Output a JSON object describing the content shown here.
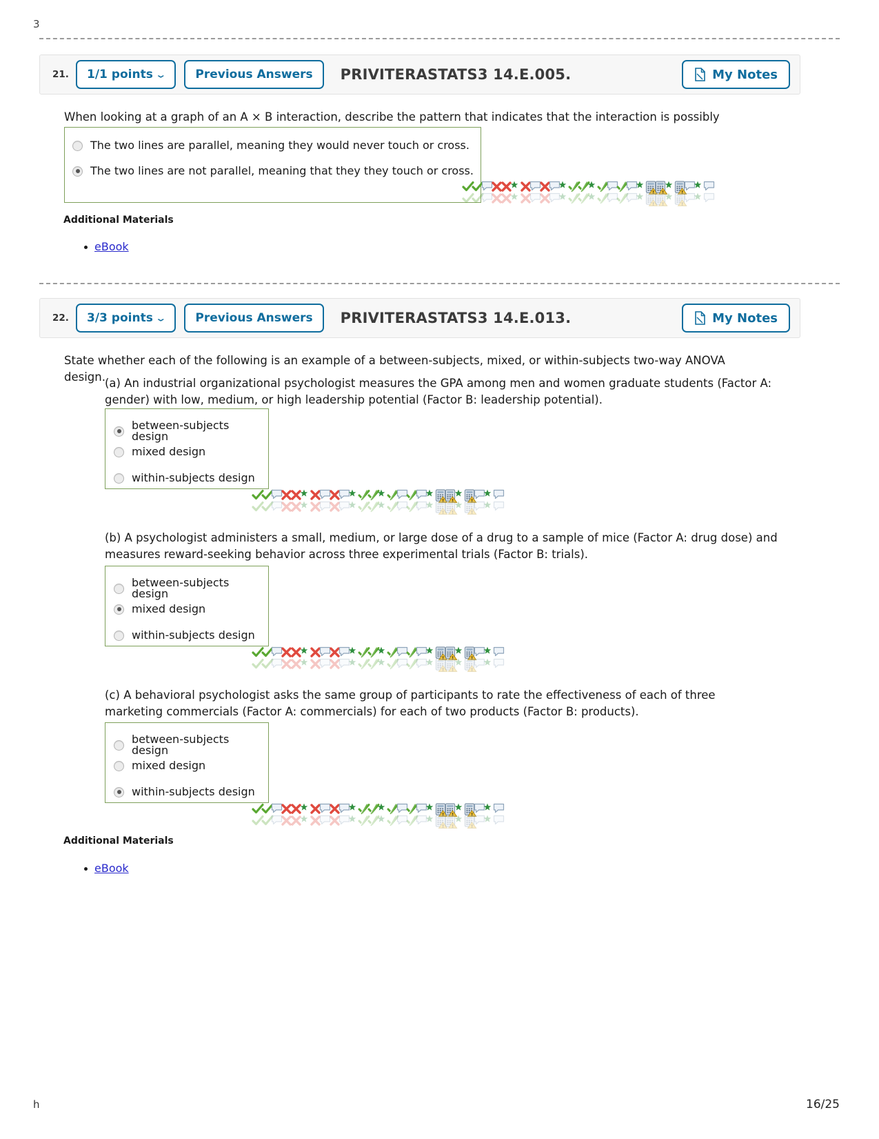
{
  "page": {
    "top_fragment": "3",
    "footer_fragment": "h",
    "page_indicator": "16/25",
    "accent_blue": "#0f6d9e",
    "link_blue": "#2a2acc",
    "option_box_border": "#7ea05a"
  },
  "questions": [
    {
      "number": "21.",
      "points_label": "1/1 points",
      "previous_answers_label": "Previous Answers",
      "code": "PRIVITERASTATS3 14.E.005.",
      "my_notes_label": "My Notes",
      "prompt": "When looking at a graph of an A  × B interaction, describe the pattern that indicates that the interaction is possibly significant.",
      "parts": [
        {
          "label": "",
          "text": "",
          "options": [
            {
              "label": "The two lines are parallel, meaning they would never touch or cross.",
              "selected": false
            },
            {
              "label": "The two lines are not parallel, meaning that they they touch or cross.",
              "selected": true
            }
          ]
        }
      ],
      "additional_materials_label": "Additional Materials",
      "materials": [
        "eBook"
      ]
    },
    {
      "number": "22.",
      "points_label": "3/3 points",
      "previous_answers_label": "Previous Answers",
      "code": "PRIVITERASTATS3 14.E.013.",
      "my_notes_label": "My Notes",
      "prompt": "State whether each of the following is an example of a between-subjects, mixed, or within-subjects two-way ANOVA design.",
      "parts": [
        {
          "label": "(a)",
          "text": "(a) An industrial organizational psychologist measures the GPA among men and women graduate students (Factor A: gender) with low, medium, or high leadership potential (Factor B: leadership potential).",
          "options": [
            {
              "label": "between-subjects design",
              "selected": true
            },
            {
              "label": "mixed design",
              "selected": false
            },
            {
              "label": "within-subjects design",
              "selected": false
            }
          ]
        },
        {
          "label": "(b)",
          "text": "(b) A psychologist administers a small, medium, or large dose of a drug to a sample of mice (Factor A: drug dose) and measures reward-seeking behavior across three experimental trials (Factor B: trials).",
          "options": [
            {
              "label": "between-subjects design",
              "selected": false
            },
            {
              "label": "mixed design",
              "selected": true
            },
            {
              "label": "within-subjects design",
              "selected": false
            }
          ]
        },
        {
          "label": "(c)",
          "text": "(c) A behavioral psychologist asks the same group of participants to rate the effectiveness of each of three marketing commercials (Factor A: commercials) for each of two products (Factor B: products).",
          "options": [
            {
              "label": "between-subjects design",
              "selected": false
            },
            {
              "label": "mixed design",
              "selected": false
            },
            {
              "label": "within-subjects design",
              "selected": true
            }
          ]
        }
      ],
      "additional_materials_label": "Additional Materials",
      "materials": [
        "eBook"
      ]
    }
  ],
  "icon_strip": {
    "sequence": [
      "check-icon",
      "check-icon",
      "speech-bubble-icon",
      "cross-icon",
      "cross-icon",
      "star-icon",
      "cross-icon",
      "speech-bubble-icon",
      "cross-icon",
      "speech-bubble-icon",
      "star-icon",
      "check-slash-icon",
      "check-slash-icon",
      "star-icon",
      "check-slash-icon",
      "speech-bubble-icon",
      "check-slash-icon",
      "speech-bubble-icon",
      "star-icon",
      "calculator-warning-icon",
      "calculator-warning-icon",
      "star-icon",
      "calculator-warning-icon",
      "speech-bubble-icon",
      "star-icon",
      "speech-bubble-icon"
    ]
  }
}
